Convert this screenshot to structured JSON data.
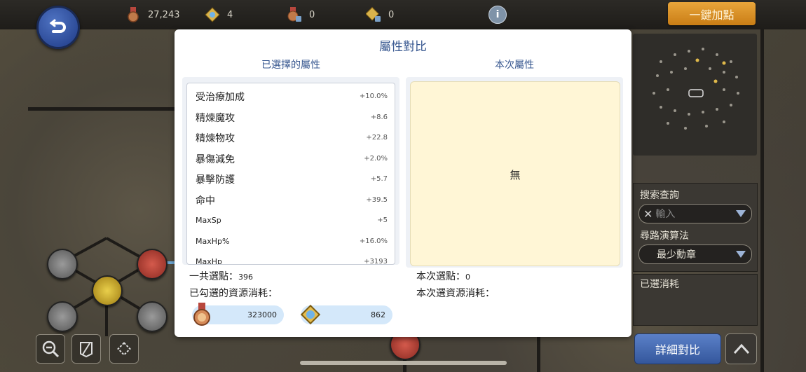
{
  "topbar": {
    "resources": [
      {
        "icon": "medal-icon",
        "value": "27,243"
      },
      {
        "icon": "gem-badge-icon",
        "value": "4"
      },
      {
        "icon": "locked-medal-icon",
        "value": "0"
      },
      {
        "icon": "locked-gem-icon",
        "value": "0"
      }
    ],
    "info_label": "i",
    "one_key_label": "一鍵加點"
  },
  "dialog": {
    "title": "屬性對比",
    "left_header": "已選擇的屬性",
    "right_header": "本次屬性",
    "attributes": [
      {
        "name": "受治療加成",
        "value": "+10.0%"
      },
      {
        "name": "精煉魔攻",
        "value": "+8.6"
      },
      {
        "name": "精煉物攻",
        "value": "+22.8"
      },
      {
        "name": "暴傷減免",
        "value": "+2.0%"
      },
      {
        "name": "暴擊防護",
        "value": "+5.7"
      },
      {
        "name": "命中",
        "value": "+39.5"
      },
      {
        "name": "MaxSp",
        "value": "+5"
      },
      {
        "name": "MaxHp%",
        "value": "+16.0%"
      },
      {
        "name": "MaxHp",
        "value": "+3193"
      }
    ],
    "right_empty_text": "無",
    "total_points_label": "一共選點：",
    "total_points_value": "396",
    "checked_cost_label": "已勾選的資源消耗：",
    "cost_medal": "323000",
    "cost_gem": "862",
    "current_points_label": "本次選點：",
    "current_points_value": "0",
    "current_cost_label": "本次選資源消耗："
  },
  "sidebar": {
    "search_label": "搜索查詢",
    "search_placeholder": "輸入",
    "algo_label": "尋路演算法",
    "algo_value": "最少勳章",
    "selected_cost_label": "已選消耗",
    "detail_button": "詳細對比"
  }
}
